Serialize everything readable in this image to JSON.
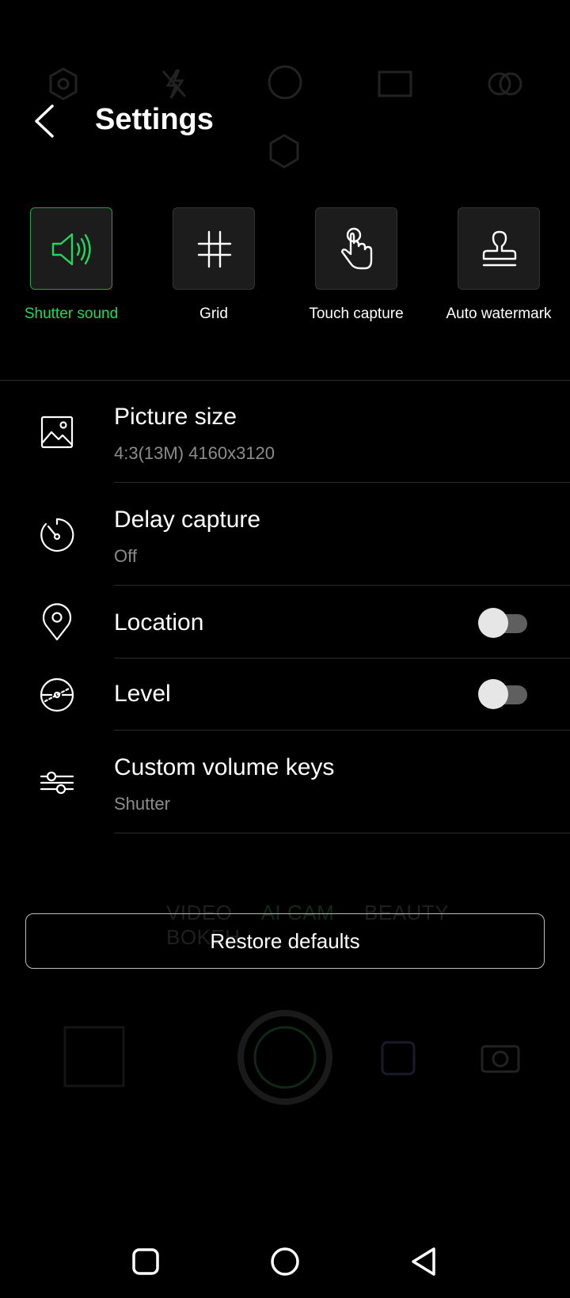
{
  "header": {
    "title": "Settings"
  },
  "quick_toggles": [
    {
      "label": "Shutter sound",
      "active": true,
      "icon": "speaker-icon"
    },
    {
      "label": "Grid",
      "active": false,
      "icon": "grid-icon"
    },
    {
      "label": "Touch capture",
      "active": false,
      "icon": "touch-icon"
    },
    {
      "label": "Auto watermark",
      "active": false,
      "icon": "stamp-icon"
    }
  ],
  "settings": {
    "picture_size": {
      "label": "Picture size",
      "value": "4:3(13M) 4160x3120"
    },
    "delay_capture": {
      "label": "Delay capture",
      "value": "Off"
    },
    "location": {
      "label": "Location",
      "enabled": false
    },
    "level": {
      "label": "Level",
      "enabled": false
    },
    "custom_volume_keys": {
      "label": "Custom volume keys",
      "value": "Shutter"
    }
  },
  "restore_label": "Restore defaults",
  "background_modes": [
    "VIDEO",
    "AI CAM",
    "BEAUTY",
    "BOKEH"
  ],
  "colors": {
    "accent": "#22d85a",
    "background": "#000000",
    "tile": "#1c1c1c"
  }
}
